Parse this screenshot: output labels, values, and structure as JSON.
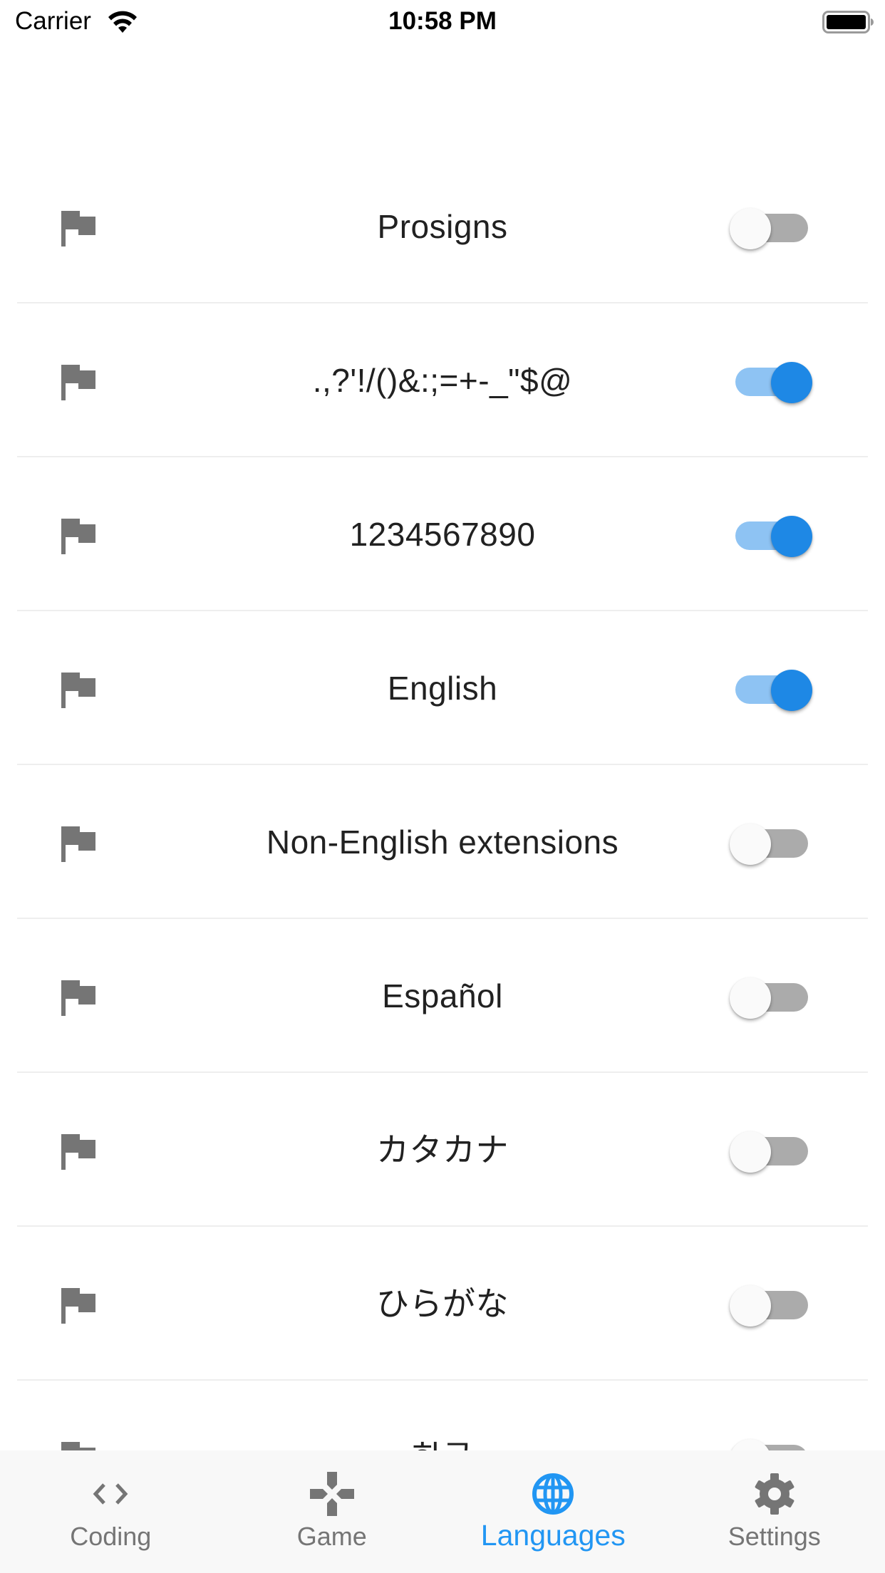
{
  "status_bar": {
    "carrier": "Carrier",
    "time": "10:58 PM",
    "wifi_icon": "wifi-icon",
    "battery_icon": "battery-full-icon"
  },
  "colors": {
    "accent": "#1e88e5",
    "accent_track": "#8ec3f3",
    "tab_active": "#2196f3",
    "tab_inactive": "#757575",
    "icon_gray": "#757575",
    "off_track": "#ababab",
    "divider": "#eeeeee",
    "tab_bar_bg": "#f8f8f8"
  },
  "languages": {
    "items": [
      {
        "icon": "flag-icon",
        "label": "Prosigns",
        "enabled": false
      },
      {
        "icon": "flag-icon",
        "label": ".,?'!/()&:;=+-_\"$@",
        "enabled": true
      },
      {
        "icon": "flag-icon",
        "label": "1234567890",
        "enabled": true
      },
      {
        "icon": "flag-icon",
        "label": "English",
        "enabled": true
      },
      {
        "icon": "flag-icon",
        "label": "Non-English extensions",
        "enabled": false
      },
      {
        "icon": "flag-icon",
        "label": "Español",
        "enabled": false
      },
      {
        "icon": "flag-icon",
        "label": "カタカナ",
        "enabled": false
      },
      {
        "icon": "flag-icon",
        "label": "ひらがな",
        "enabled": false
      },
      {
        "icon": "flag-icon",
        "label": "한글",
        "enabled": false
      }
    ]
  },
  "tab_bar": {
    "active_index": 2,
    "tabs": [
      {
        "label": "Coding",
        "icon": "code-icon"
      },
      {
        "label": "Game",
        "icon": "gamepad-icon"
      },
      {
        "label": "Languages",
        "icon": "globe-icon"
      },
      {
        "label": "Settings",
        "icon": "gear-icon"
      }
    ]
  }
}
